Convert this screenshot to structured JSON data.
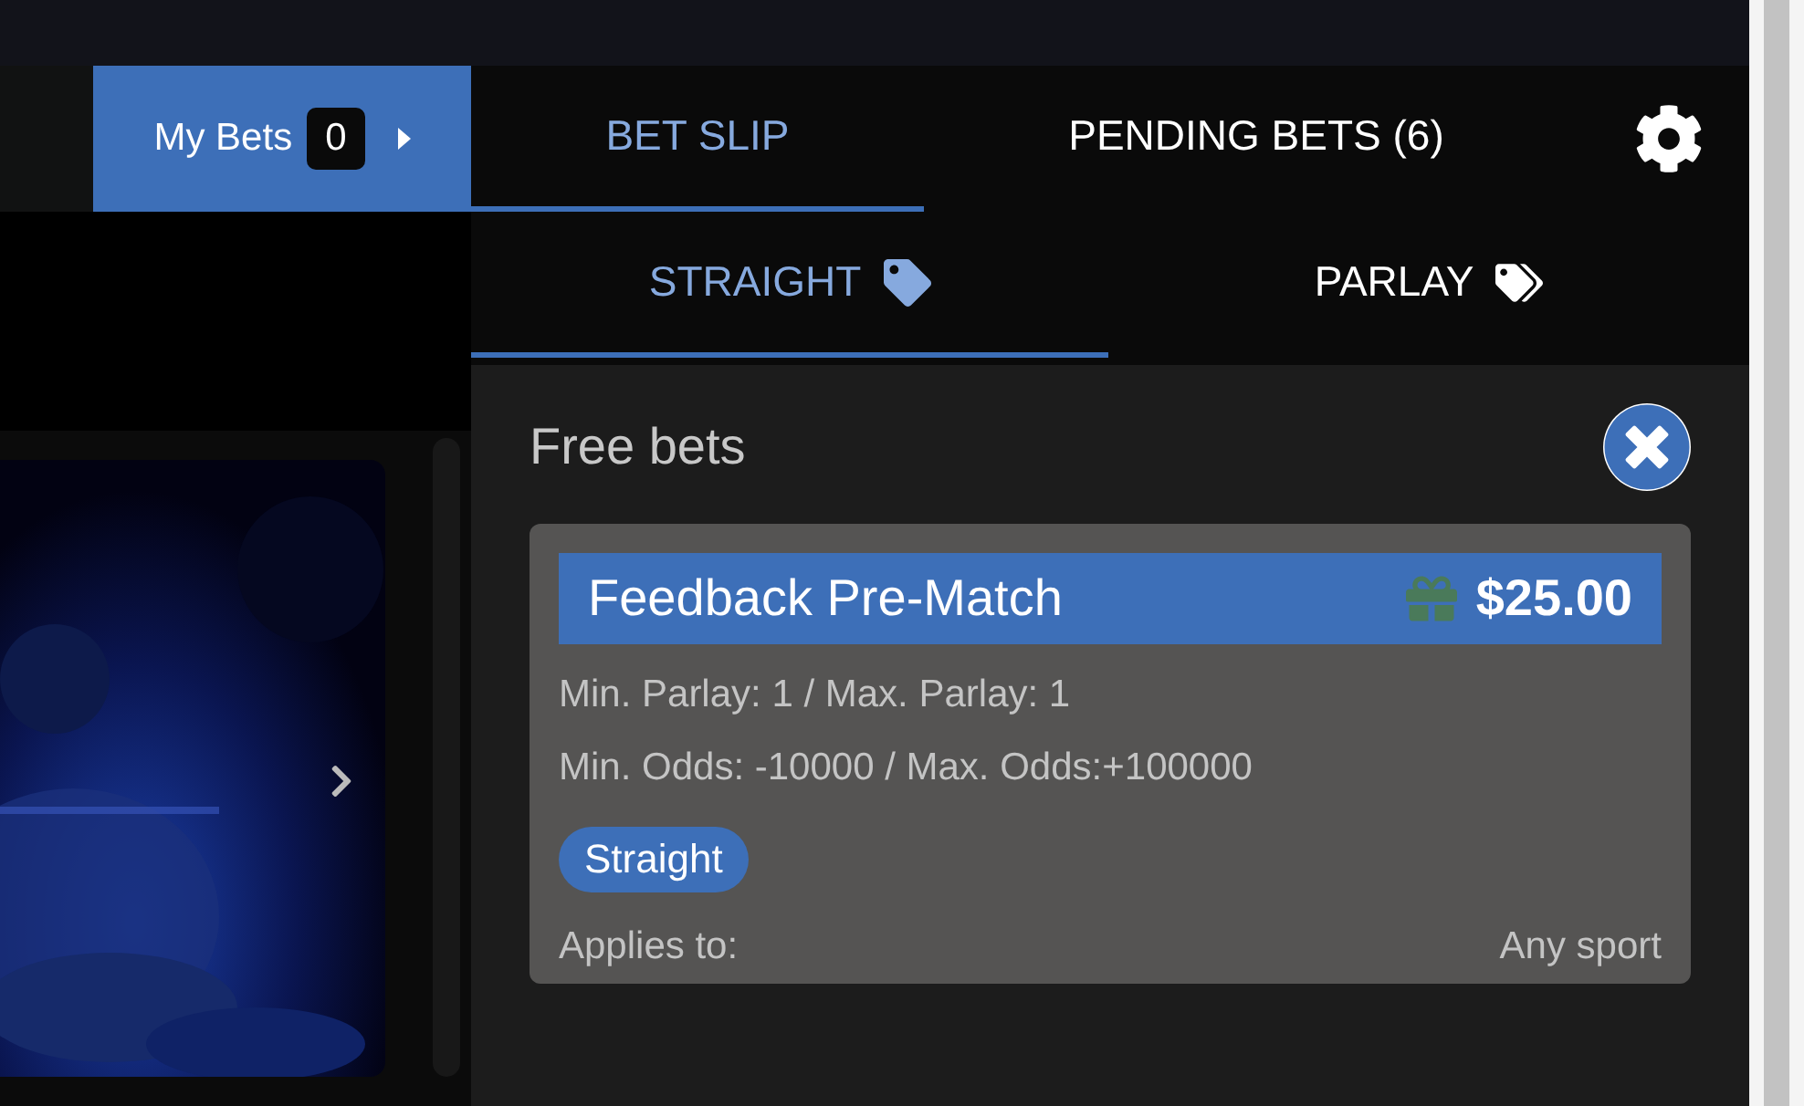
{
  "my_bets": {
    "label": "My Bets",
    "count": "0"
  },
  "tabs": [
    {
      "label": "BET SLIP",
      "selected": true
    },
    {
      "label": "PENDING BETS (6)",
      "selected": false
    }
  ],
  "bet_types": [
    {
      "label": "STRAIGHT",
      "selected": true,
      "kind": "single"
    },
    {
      "label": "PARLAY",
      "selected": false,
      "kind": "multi"
    }
  ],
  "free_bets": {
    "title": "Free bets",
    "cards": [
      {
        "name": "Feedback Pre-Match",
        "amount": "$25.00",
        "lines": [
          "Min. Parlay: 1 / Max. Parlay: 1",
          "Min. Odds: -10000 / Max. Odds:+100000"
        ],
        "tag": "Straight",
        "applies_label": "Applies to:",
        "applies_value": "Any sport"
      }
    ]
  }
}
